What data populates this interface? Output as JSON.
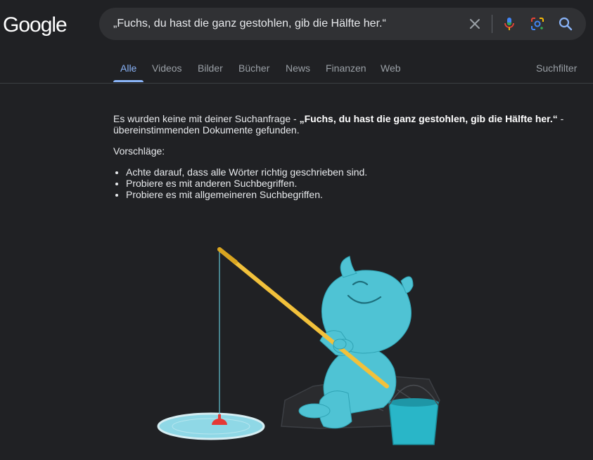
{
  "logo": {
    "text": "Google"
  },
  "search": {
    "query": "„Fuchs, du hast die ganz gestohlen, gib die Hälfte her.“",
    "icons": [
      "close-icon",
      "microphone-icon",
      "lens-icon",
      "search-icon"
    ]
  },
  "tabs": {
    "items": [
      "Alle",
      "Videos",
      "Bilder",
      "Bücher",
      "News",
      "Finanzen",
      "Web"
    ],
    "active": "Alle",
    "filter": "Suchfilter"
  },
  "results": {
    "no_results_prefix": "Es wurden keine mit deiner Suchanfrage - ",
    "query_bold": "„Fuchs, du hast die ganz gestohlen, gib die Hälfte her.“",
    "no_results_suffix": " - übereinstimmenden Dokumente gefunden.",
    "suggestions_heading": "Vorschläge:",
    "suggestions": [
      "Achte darauf, dass alle Wörter richtig geschrieben sind.",
      "Probiere es mit anderen Suchbegriffen.",
      "Probiere es mit allgemeineren Suchbegriffen."
    ]
  },
  "colors": {
    "background": "#202124",
    "accent": "#8ab4f8",
    "searchbar": "#303134",
    "yeti": "#4fc3d4"
  }
}
